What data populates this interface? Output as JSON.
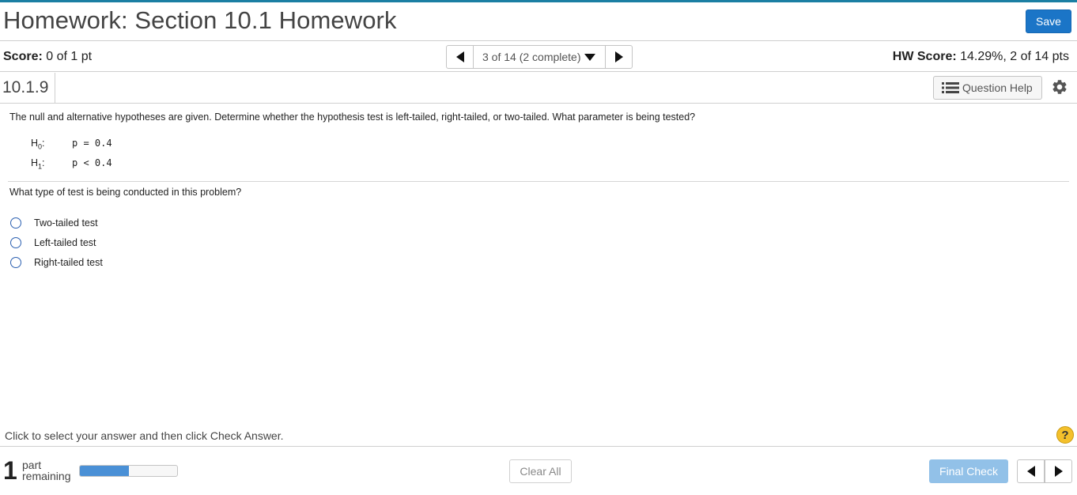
{
  "header": {
    "title": "Homework: Section 10.1 Homework",
    "save_label": "Save"
  },
  "scorebar": {
    "score_label": "Score:",
    "score_value": " 0 of 1 pt",
    "nav_position": "3 of 14 (2 complete)",
    "hw_score_label": "HW Score:",
    "hw_score_value": " 14.29%, 2 of 14 pts"
  },
  "question_bar": {
    "number": "10.1.9",
    "help_label": "Question Help"
  },
  "question": {
    "text": "The null and alternative hypotheses are given. Determine whether the hypothesis test is left-tailed, right-tailed, or two-tailed. What parameter is being tested?",
    "hypotheses": [
      {
        "symbol": "H",
        "sub": "0",
        "colon": ":",
        "expr": "p = 0.4"
      },
      {
        "symbol": "H",
        "sub": "1",
        "colon": ":",
        "expr": "p < 0.4"
      }
    ],
    "prompt": "What type of test is being conducted in this problem?",
    "options": [
      {
        "label": "Two-tailed test"
      },
      {
        "label": "Left-tailed test"
      },
      {
        "label": "Right-tailed test"
      }
    ]
  },
  "instruction": "Click to select your answer and then click Check Answer.",
  "help_circle": "?",
  "footer": {
    "parts_count": "1",
    "parts_line1": "part",
    "parts_line2": "remaining",
    "progress_percent": 50,
    "clear_label": "Clear All",
    "final_label": "Final Check"
  },
  "colors": {
    "accent": "#1b75c7",
    "top_bar": "#1b7fa3",
    "radio": "#2a5fb0",
    "progress": "#4a90d6",
    "final_check": "#92c1e8",
    "help_circle": "#f4c02b"
  }
}
